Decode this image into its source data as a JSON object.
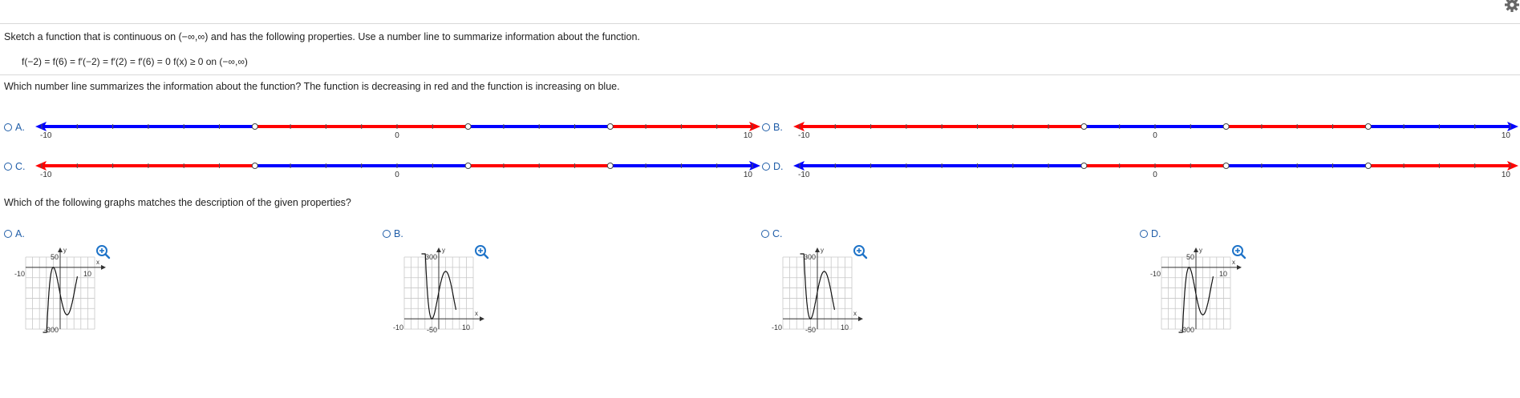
{
  "question1": "Sketch a function that is continuous on (−∞,∞) and has the following properties. Use a number line to summarize information about the function.",
  "given": "f(−2) = f(6) = f′(−2) = f′(2) = f′(6) = 0   f(x) ≥ 0 on (−∞,∞)",
  "question2": "Which number line summarizes the information about the function? The function is decreasing in red and the function is increasing on blue.",
  "question3": "Which of the following graphs matches the description of the given properties?",
  "colors": {
    "decreasing": "#ff0000",
    "increasing": "#0000ff",
    "option": "#1f5da8",
    "zoom": "#1e73c8"
  },
  "icons": {
    "settings": "gear-icon",
    "zoom": "zoom-in-icon"
  },
  "numberline_options": [
    {
      "label": "A.",
      "min": "-10",
      "zero": "0",
      "max": "10",
      "segments": [
        {
          "from": -10,
          "to": -4,
          "color": "increasing"
        },
        {
          "from": -4,
          "to": 2,
          "color": "decreasing"
        },
        {
          "from": 2,
          "to": 6,
          "color": "increasing"
        },
        {
          "from": 6,
          "to": 10,
          "color": "decreasing"
        }
      ],
      "points": [
        -4,
        2,
        6
      ]
    },
    {
      "label": "B.",
      "min": "-10",
      "zero": "0",
      "max": "10",
      "segments": [
        {
          "from": -10,
          "to": -2,
          "color": "decreasing"
        },
        {
          "from": -2,
          "to": 2,
          "color": "increasing"
        },
        {
          "from": 2,
          "to": 6,
          "color": "decreasing"
        },
        {
          "from": 6,
          "to": 10,
          "color": "increasing"
        }
      ],
      "points": [
        -2,
        2,
        6
      ]
    },
    {
      "label": "C.",
      "min": "-10",
      "zero": "0",
      "max": "10",
      "segments": [
        {
          "from": -10,
          "to": -4,
          "color": "decreasing"
        },
        {
          "from": -4,
          "to": 2,
          "color": "increasing"
        },
        {
          "from": 2,
          "to": 6,
          "color": "decreasing"
        },
        {
          "from": 6,
          "to": 10,
          "color": "increasing"
        }
      ],
      "points": [
        -4,
        2,
        6
      ]
    },
    {
      "label": "D.",
      "min": "-10",
      "zero": "0",
      "max": "10",
      "segments": [
        {
          "from": -10,
          "to": -2,
          "color": "increasing"
        },
        {
          "from": -2,
          "to": 2,
          "color": "decreasing"
        },
        {
          "from": 2,
          "to": 6,
          "color": "increasing"
        },
        {
          "from": 6,
          "to": 10,
          "color": "decreasing"
        }
      ],
      "points": [
        -2,
        2,
        6
      ]
    }
  ],
  "graph_options": [
    {
      "label": "A.",
      "xmin_label": "-10",
      "xmax_label": "10",
      "ytop_label": "50",
      "ybottom_label": "-300",
      "x_label": "x",
      "y_label": "y",
      "ymin": -300,
      "ymax": 50,
      "sign": -1
    },
    {
      "label": "B.",
      "xmin_label": "-10",
      "xmax_label": "10",
      "ytop_label": "300",
      "ybottom_label": "-50",
      "x_label": "x",
      "y_label": "y",
      "ymin": -50,
      "ymax": 300,
      "sign": 1
    },
    {
      "label": "C.",
      "xmin_label": "-10",
      "xmax_label": "10",
      "ytop_label": "300",
      "ybottom_label": "-50",
      "x_label": "x",
      "y_label": "y",
      "ymin": -50,
      "ymax": 300,
      "sign": 1
    },
    {
      "label": "D.",
      "xmin_label": "-10",
      "xmax_label": "10",
      "ytop_label": "50",
      "ybottom_label": "-300",
      "x_label": "x",
      "y_label": "y",
      "ymin": -300,
      "ymax": 50,
      "sign": -1
    }
  ]
}
